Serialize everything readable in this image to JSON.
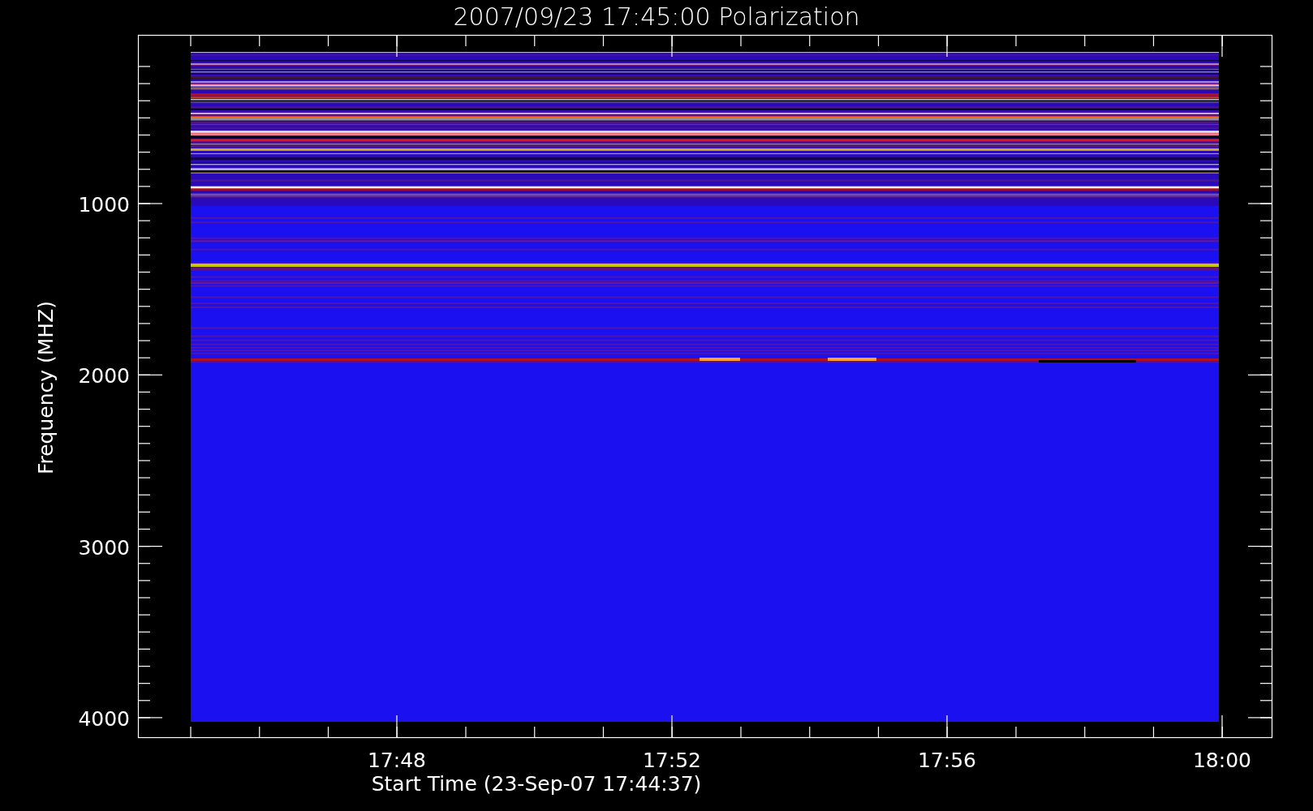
{
  "title": "2007/09/23 17:45:00 Polarization",
  "y_axis": {
    "label": "Frequency (MHZ)",
    "ticks": [
      "1000",
      "2000",
      "3000",
      "4000"
    ]
  },
  "x_axis": {
    "label": "Start Time (23-Sep-07 17:44:37)",
    "ticks": [
      "17:48",
      "17:52",
      "17:56",
      "18:00"
    ]
  }
}
